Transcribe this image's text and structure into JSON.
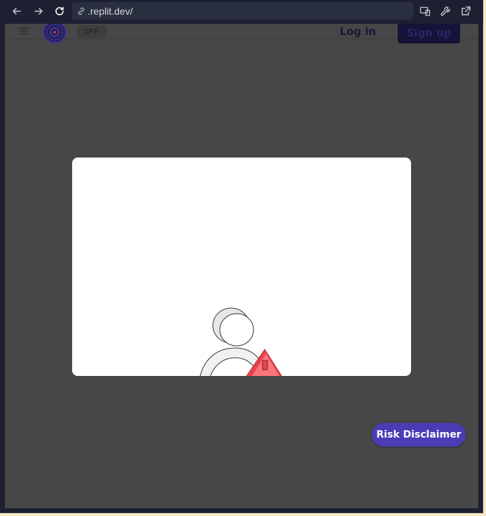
{
  "browser": {
    "url": ".replit.dev/",
    "back_icon": "arrow-left-icon",
    "forward_icon": "arrow-right-icon",
    "reload_icon": "reload-icon",
    "devices_icon": "devices-icon",
    "devtools_icon": "wrench-icon",
    "open_external_icon": "external-link-icon"
  },
  "site_header": {
    "menu_icon": "hamburger-icon",
    "toggle_label": "OFF",
    "login_label": "Log in",
    "signup_label": "Sign up"
  },
  "floating": {
    "risk_disclaimer_label": "Risk Disclaimer"
  },
  "colors": {
    "overlay": "#474747",
    "accent": "#4a3cb5",
    "warning": "#f2545b"
  }
}
